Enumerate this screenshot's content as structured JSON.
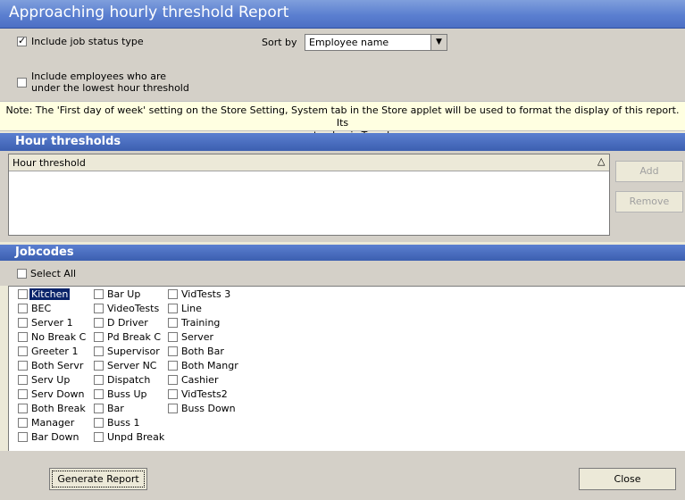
{
  "window": {
    "title": "Approaching hourly threshold Report"
  },
  "options": {
    "include_job_status": {
      "label": "Include job status type",
      "checked": true
    },
    "sort_by": {
      "label": "Sort by",
      "value": "Employee name"
    },
    "include_lowest": {
      "line1": "Include employees who are",
      "line2": "under the lowest hour threshold",
      "checked": false
    }
  },
  "note": {
    "line1": "Note: The 'First day of week' setting on the Store Setting, System tab in the Store applet will be used to format the display of this report. Its",
    "line2": "current value is Tuesday."
  },
  "hour_thresholds": {
    "title": "Hour thresholds",
    "column": "Hour threshold",
    "sort_icon": "triangle-up",
    "add_label": "Add",
    "remove_label": "Remove"
  },
  "jobcodes": {
    "title": "Jobcodes",
    "select_all": "Select All",
    "col1": [
      "Kitchen",
      "BEC",
      "Server 1",
      "No Break C",
      "Greeter 1",
      "Both Servr",
      "Serv Up",
      "Serv Down",
      "Both Break",
      "Manager",
      "Bar Down"
    ],
    "col2": [
      "Bar Up",
      "VideoTests",
      "D Driver",
      "Pd Break C",
      "Supervisor",
      "Server NC",
      "Dispatch",
      "Buss Up",
      "Bar",
      "Buss 1",
      "Unpd Break"
    ],
    "col3": [
      "VidTests 3",
      "Line",
      "Training",
      "Server",
      "Both Bar",
      "Both Mangr",
      "Cashier",
      "VidTests2",
      "Buss Down"
    ]
  },
  "footer": {
    "generate_label": "Generate Report",
    "close_label": "Close"
  }
}
